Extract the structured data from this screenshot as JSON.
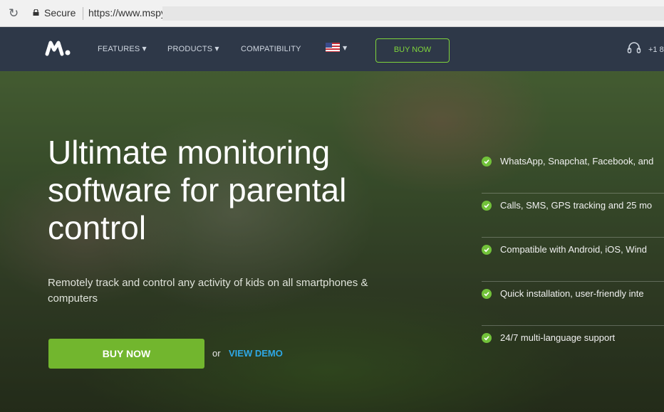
{
  "browser": {
    "secure_label": "Secure",
    "url": "https://www.mspy.com"
  },
  "nav": {
    "items": [
      {
        "label": "FEATURES"
      },
      {
        "label": "PRODUCTS"
      },
      {
        "label": "COMPATIBILITY"
      }
    ],
    "buy_label": "BUY NOW",
    "phone": "+1 8"
  },
  "hero": {
    "title": "Ultimate monitoring software for parental control",
    "subtitle": "Remotely track and control any activity of kids on all smartphones & computers",
    "buy_label": "BUY NOW",
    "or_text": "or",
    "demo_label": "VIEW DEMO"
  },
  "features": [
    "WhatsApp, Snapchat, Facebook, and",
    "Calls, SMS, GPS tracking and 25 mo",
    "Compatible with Android, iOS, Wind",
    "Quick installation, user-friendly inte",
    "24/7 multi-language support"
  ],
  "colors": {
    "nav_bg": "#2e3848",
    "accent_green": "#72b62e",
    "link_blue": "#2ea8e6"
  },
  "icons": [
    "reload-icon",
    "lock-icon",
    "mspy-logo",
    "chevron-down-icon",
    "us-flag-icon",
    "headset-icon",
    "check-circle-icon"
  ]
}
